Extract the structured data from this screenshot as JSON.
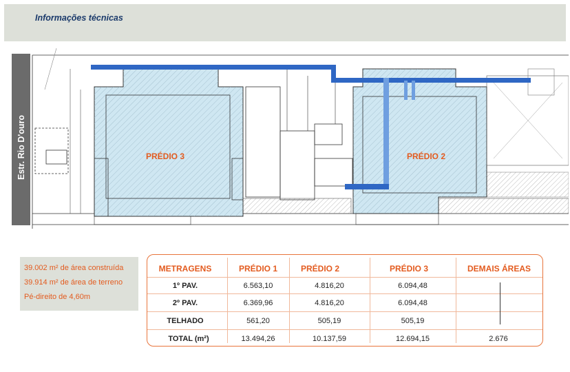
{
  "header": {
    "title": "Informações técnicas"
  },
  "plan": {
    "street_label": "Estr. Rio D'ouro",
    "building_left_label": "PRÉDIO 3",
    "building_right_label": "PRÉDIO 2"
  },
  "summary": {
    "lines": [
      "39.002 m² de área construída",
      "39.914 m² de área de terreno",
      "Pé-direito de 4,60m"
    ]
  },
  "table": {
    "headers": [
      "METRAGENS",
      "PRÉDIO 1",
      "PRÉDIO 2",
      "PRÉDIO 3",
      "DEMAIS ÁREAS"
    ],
    "rows": [
      {
        "label": "1º PAV.",
        "values": [
          "6.563,10",
          "4.816,20",
          "6.094,48",
          ""
        ]
      },
      {
        "label": "2º PAV.",
        "values": [
          "6.369,96",
          "4.816,20",
          "6.094,48",
          ""
        ]
      },
      {
        "label": "TELHADO",
        "values": [
          "561,20",
          "505,19",
          "505,19",
          ""
        ]
      },
      {
        "label": "TOTAL (m²)",
        "values": [
          "13.494,26",
          "10.137,59",
          "12.694,15",
          "2.676"
        ]
      }
    ]
  },
  "colors": {
    "accent_orange": "#e35b1f",
    "header_band": "#dde0d9",
    "title_blue": "#1b3a6b",
    "building_fill": "#cfe7f2",
    "pipe_blue": "#2f67c4"
  }
}
